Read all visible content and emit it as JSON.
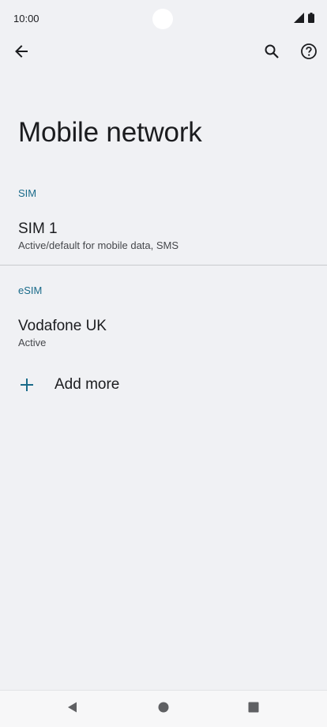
{
  "status_bar": {
    "time": "10:00",
    "icons": [
      "signal-icon",
      "battery-icon"
    ]
  },
  "top_bar": {
    "back_icon": "arrow-left-icon",
    "search_icon": "search-icon",
    "help_icon": "help-circle-icon"
  },
  "page": {
    "title": "Mobile network"
  },
  "sections": {
    "sim": {
      "header": "SIM",
      "items": [
        {
          "title": "SIM 1",
          "summary": "Active/default for mobile data, SMS"
        }
      ]
    },
    "esim": {
      "header": "eSIM",
      "items": [
        {
          "title": "Vodafone UK",
          "summary": "Active"
        }
      ]
    }
  },
  "add_more": {
    "label": "Add more",
    "icon": "plus-icon"
  },
  "nav_bar": {
    "icons": [
      "nav-back-icon",
      "nav-home-icon",
      "nav-recents-icon"
    ]
  },
  "colors": {
    "background": "#f0f1f4",
    "accent": "#1a6b8a",
    "text_primary": "#1b1c1f",
    "text_secondary": "#45474b",
    "nav_icon": "#5f6063"
  }
}
